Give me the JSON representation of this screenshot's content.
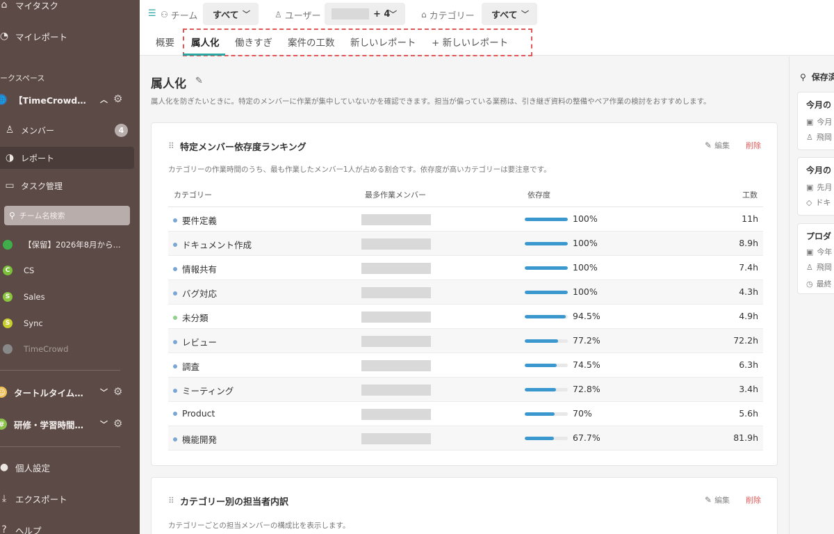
{
  "sidebar": {
    "my_task": "マイタスク",
    "my_report": "マイレポート",
    "workspace_section": "ークスペース",
    "workspace_main": "【TimeCrowd】...",
    "members_label": "メンバー",
    "members_count": "4",
    "reports_label": "レポート",
    "task_mgmt_label": "タスク管理",
    "team_search_placeholder": "チーム名検索",
    "teams": [
      {
        "name": "【保留】2026年8月から...",
        "color": "#3fae4a",
        "initial": ""
      },
      {
        "name": "CS",
        "color": "#7cbf3a",
        "initial": "C"
      },
      {
        "name": "Sales",
        "color": "#8cc63f",
        "initial": "S"
      },
      {
        "name": "Sync",
        "color": "#c9cf2e",
        "initial": "S"
      },
      {
        "name": "TimeCrowd",
        "color": "#888888",
        "initial": ""
      }
    ],
    "workspace_2": "タートルタイム株...",
    "workspace_3": "研修・学習時間記...",
    "personal_settings": "個人設定",
    "export": "エクスポート",
    "help": "ヘルプ"
  },
  "filters": {
    "team_label": "チーム",
    "team_value": "すべて",
    "user_label": "ユーザー",
    "user_extra": "+ 4",
    "category_label": "カテゴリー",
    "category_value": "すべて"
  },
  "tabs": {
    "overview": "概要",
    "items": [
      "属人化",
      "働きすぎ",
      "案件の工数",
      "新しいレポート"
    ],
    "add": "+ 新しいレポート"
  },
  "page": {
    "title": "属人化",
    "description": "属人化を防ぎたいときに。特定のメンバーに作業が集中していないかを確認できます。担当が偏っている業務は、引き継ぎ資料の整備やペア作業の検討をおすすめします。"
  },
  "card1": {
    "title": "特定メンバー依存度ランキング",
    "edit": "編集",
    "delete": "削除",
    "description": "カテゴリーの作業時間のうち、最も作業したメンバー1人が占める割合です。依存度が高いカテゴリーは要注意です。",
    "headers": {
      "category": "カテゴリー",
      "member": "最多作業メンバー",
      "dependency": "依存度",
      "hours": "工数"
    },
    "rows": [
      {
        "category": "要件定義",
        "dot": "#7aa6d6",
        "pct_value": 100,
        "pct": "100%",
        "hours": "11h"
      },
      {
        "category": "ドキュメント作成",
        "dot": "#7aa6d6",
        "pct_value": 100,
        "pct": "100%",
        "hours": "8.9h"
      },
      {
        "category": "情報共有",
        "dot": "#7aa6d6",
        "pct_value": 100,
        "pct": "100%",
        "hours": "7.4h"
      },
      {
        "category": "バグ対応",
        "dot": "#7aa6d6",
        "pct_value": 100,
        "pct": "100%",
        "hours": "4.3h"
      },
      {
        "category": "未分類",
        "dot": "#8fd08a",
        "pct_value": 94.5,
        "pct": "94.5%",
        "hours": "4.9h"
      },
      {
        "category": "レビュー",
        "dot": "#7aa6d6",
        "pct_value": 77.2,
        "pct": "77.2%",
        "hours": "72.2h"
      },
      {
        "category": "調査",
        "dot": "#7aa6d6",
        "pct_value": 74.5,
        "pct": "74.5%",
        "hours": "6.3h"
      },
      {
        "category": "ミーティング",
        "dot": "#7aa6d6",
        "pct_value": 72.8,
        "pct": "72.8%",
        "hours": "3.4h"
      },
      {
        "category": "Product",
        "dot": "#7aa6d6",
        "pct_value": 70,
        "pct": "70%",
        "hours": "5.6h"
      },
      {
        "category": "機能開発",
        "dot": "#7aa6d6",
        "pct_value": 67.7,
        "pct": "67.7%",
        "hours": "81.9h"
      }
    ]
  },
  "card2": {
    "title": "カテゴリー別の担当者内訳",
    "edit": "編集",
    "delete": "削除",
    "description": "カテゴリーごとの担当メンバーの構成比を表示します。"
  },
  "right_panel": {
    "title": "保存済",
    "cards": [
      {
        "title": "今月の",
        "lines": [
          {
            "icon": "calendar-icon",
            "text": "今月"
          },
          {
            "icon": "person-icon",
            "text": "飛岡"
          }
        ]
      },
      {
        "title": "今月の",
        "lines": [
          {
            "icon": "calendar-icon",
            "text": "先月"
          },
          {
            "icon": "tag-icon",
            "text": "ドキ"
          }
        ]
      },
      {
        "title": "プロダ",
        "lines": [
          {
            "icon": "calendar-icon",
            "text": "今年"
          },
          {
            "icon": "person-icon",
            "text": "飛岡"
          },
          {
            "icon": "clock-icon",
            "text": "最終"
          }
        ]
      }
    ]
  },
  "colors": {
    "sidebar": "#5b4a46",
    "accent": "#2aa5a0",
    "bar": "#3a98cf",
    "delete": "#e05a5a",
    "dashed_box": "#e05555"
  }
}
